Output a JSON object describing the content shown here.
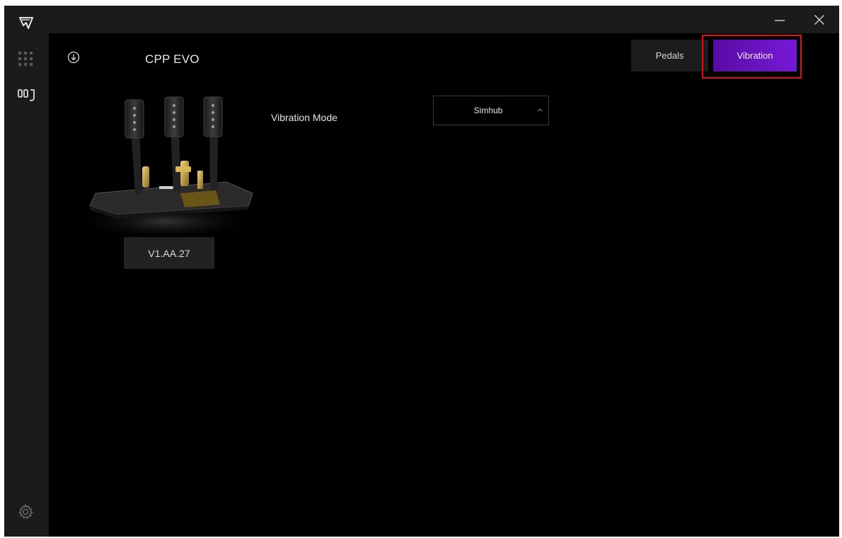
{
  "header": {
    "device_title": "CPP EVO"
  },
  "tabs": [
    {
      "label": "Pedals",
      "active": false
    },
    {
      "label": "Vibration",
      "active": true
    }
  ],
  "device": {
    "firmware_version": "V1.AA.27"
  },
  "settings": {
    "vibration_mode_label": "Vibration Mode",
    "vibration_mode_value": "Simhub"
  },
  "colors": {
    "accent": "#6a12c4",
    "highlight_box": "#e01010",
    "sidebar_bg": "#1b1b1b",
    "main_bg": "#000000"
  },
  "icons": {
    "logo": "brand-logo-icon",
    "apps": "grid-icon",
    "pedals_nav": "pedals-icon",
    "settings": "gear-icon",
    "update": "download-circle-icon",
    "minimize": "minimize-icon",
    "close": "close-icon",
    "select": "chevron-up-icon"
  }
}
